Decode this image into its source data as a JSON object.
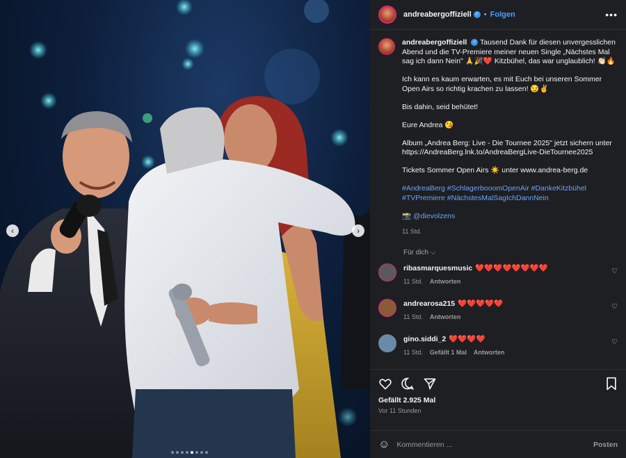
{
  "post": {
    "username": "andreabergoffiziell",
    "follow_label": "Folgen",
    "more_label": "•••",
    "separator": "•"
  },
  "caption": {
    "username": "andreabergoffiziell",
    "p1": "Tausend Dank für diesen unvergesslichen Abend und die TV-Premiere meiner neuen Single „Nächstes Mal sag ich dann Nein\" 🙏🎉❤️ Kitzbühel, das war unglaublich! 👏🏻🔥",
    "p2": "Ich kann es kaum erwarten, es mit Euch bei unseren Sommer Open Airs so richtig krachen zu lassen! 😏✌️",
    "p3": "Bis dahin, seid behütet!",
    "p4": "Eure Andrea 😘",
    "p5": "Album „Andrea Berg: Live - Die Tournee 2025\" jetzt sichern unter https://AndreaBerg.lnk.to/AndreaBergLive-DieTournee2025",
    "p6": "Tickets Sommer Open Airs ☀️ unter www.andrea-berg.de",
    "hashtags": "#AndreaBerg #SchlagerbooomOpenAir #DankeKitzbühel #TVPremiere #NächstesMalSagIchDannNein",
    "credit_icon": "📸",
    "credit": "@dievolzens",
    "time": "11 Std."
  },
  "fuer_dich": "Für dich ⌵",
  "comments": [
    {
      "user": "ribasmarquesmusic",
      "text": "❤️❤️❤️❤️❤️❤️❤️❤️",
      "time": "11 Std.",
      "likes": "",
      "reply": "Antworten",
      "avatar_color": "#5a5a5a"
    },
    {
      "user": "andrearosa215",
      "text": "❤️❤️❤️❤️❤️",
      "time": "11 Std.",
      "likes": "",
      "reply": "Antworten",
      "avatar_color": "#8a5a3a"
    },
    {
      "user": "gino.siddi_2",
      "text": "❤️❤️❤️❤️",
      "time": "11 Std.",
      "likes": "Gefällt 1 Mal",
      "reply": "Antworten",
      "avatar_color": "#6a8aa8"
    }
  ],
  "actions": {
    "heart_icon": "heart-icon",
    "comment_icon": "comment-icon",
    "share_icon": "share-icon",
    "save_icon": "bookmark-icon",
    "likes": "Gefällt 2.925 Mal",
    "ago": "Vor 11 Stunden"
  },
  "compose": {
    "placeholder": "Kommentieren ...",
    "post_label": "Posten"
  },
  "nav": {
    "prev": "‹",
    "next": "›"
  },
  "carousel": {
    "count": 8,
    "active": 5
  },
  "colors": {
    "accent": "#4a9fff",
    "panel": "#1e1f22",
    "ring": "#d62976"
  }
}
